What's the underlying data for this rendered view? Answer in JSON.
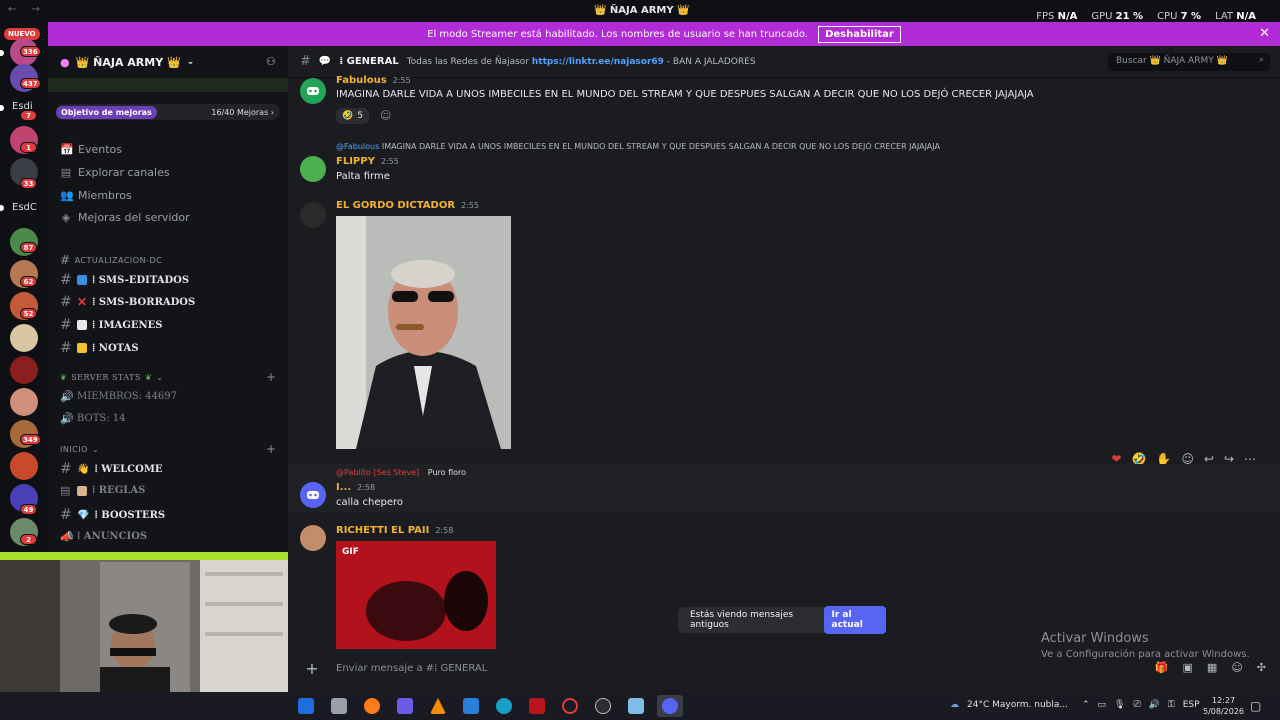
{
  "window": {
    "title": "👑 ÑAJA ARMY 👑",
    "nav": "← →"
  },
  "perf": [
    {
      "label": "FPS",
      "value": "N/A"
    },
    {
      "label": "GPU",
      "value": "21 %"
    },
    {
      "label": "CPU",
      "value": "7 %"
    },
    {
      "label": "LAT",
      "value": "N/A"
    }
  ],
  "banner": {
    "text": "El modo Streamer está habilitado. Los nombres de usuario se han truncado.",
    "button": "Deshabilitar",
    "close": "✕"
  },
  "rail": {
    "nuevo": "NUEVO",
    "badges": [
      "336",
      "437",
      "7",
      "1",
      "33",
      "87",
      "62",
      "52",
      "349",
      "49",
      "2"
    ],
    "labels": [
      "Esdi",
      "EsdC"
    ]
  },
  "sidebar": {
    "server_name": "👑 ÑAJA ARMY 👑",
    "goal_label": "Objetivo de mejoras",
    "goal_progress": "16/40 Mejoras",
    "nav": [
      {
        "label": "Eventos",
        "icon": "📅"
      },
      {
        "label": "Explorar canales",
        "icon": "▤"
      },
      {
        "label": "Miembros",
        "icon": "👥"
      },
      {
        "label": "Mejoras del servidor",
        "icon": "◈"
      }
    ],
    "cat_actualizacion": "ACTUALIZACION-DC",
    "chan_sms_editados": "⁞ SMS-EDITADOS",
    "chan_sms_borrados": "⁞ SMS-BORRADOS",
    "chan_imagenes": "⁞ IMAGENES",
    "chan_notas": "⁞ NOTAS",
    "cat_server_stats": "SERVER STATS",
    "stat_miembros": "MIEMBROS: 44697",
    "stat_bots": "BOTS: 14",
    "cat_inicio": "INICIO",
    "chan_welcome": "⁞ WELCOME",
    "chan_reglas": "⁞ REGLAS",
    "chan_boosters": "⁞ BOOSTERS",
    "chan_anuncios": "⁞ ANUNCIOS"
  },
  "header": {
    "channel": "⁞ GENERAL",
    "topic_prefix": "Todas las Redes de Ñajasor",
    "topic_link": "https://linktr.ee/najasor69",
    "topic_suffix": "- BAN A JALADORES",
    "search_placeholder": "Buscar 👑 ÑAJA ARMY 👑"
  },
  "messages": {
    "m1_user": "Fabulous",
    "m1_time": "2:55",
    "m1_text": "IMAGINA DARLE VIDA A UNOS IMBECILES EN EL MUNDO DEL STREAM Y QUE DESPUES SALGAN A DECIR QUE NO LOS DEJÓ CRECER JAJAJAJA",
    "m1_react_count": "5",
    "m2_reply_user": "@Fabulous",
    "m2_reply_text": "IMAGINA DARLE VIDA A UNOS IMBECILES EN EL MUNDO DEL STREAM Y QUE DESPUES SALGAN A DECIR QUE NO LOS DEJÓ CRECER JAJAJAJA",
    "m2_user": "FLIPPY",
    "m2_time": "2:55",
    "m2_text": "Palta firme",
    "m3_user": "EL GORDO DICTADOR",
    "m3_time": "2:55",
    "m4_reply_user": "@Pablito",
    "m4_reply_tag": "[Ses Steve]",
    "m4_reply_text": "Puro floro",
    "m4_user": "I...",
    "m4_time": "2:58",
    "m4_text": "calla chepero",
    "m5_user": "RICHETTI EL PAII",
    "m5_time": "2:58",
    "m5_gif": "GIF"
  },
  "old_messages": {
    "text": "Estás viendo mensajes antiguos",
    "button": "Ir al actual"
  },
  "composer": {
    "placeholder": "Enviar mensaje a #⁞ GENERAL"
  },
  "watermark": {
    "line1": "Activar Windows",
    "line2": "Ve a Configuración para activar Windows."
  },
  "taskbar": {
    "weather": "24°C  Mayorm. nubla...",
    "lang": "ESP",
    "time": "12:27",
    "date": "5/08/2026"
  },
  "colors": {
    "accent": "#5865f2",
    "banner": "#b12bd6",
    "username": "#f0b232"
  }
}
